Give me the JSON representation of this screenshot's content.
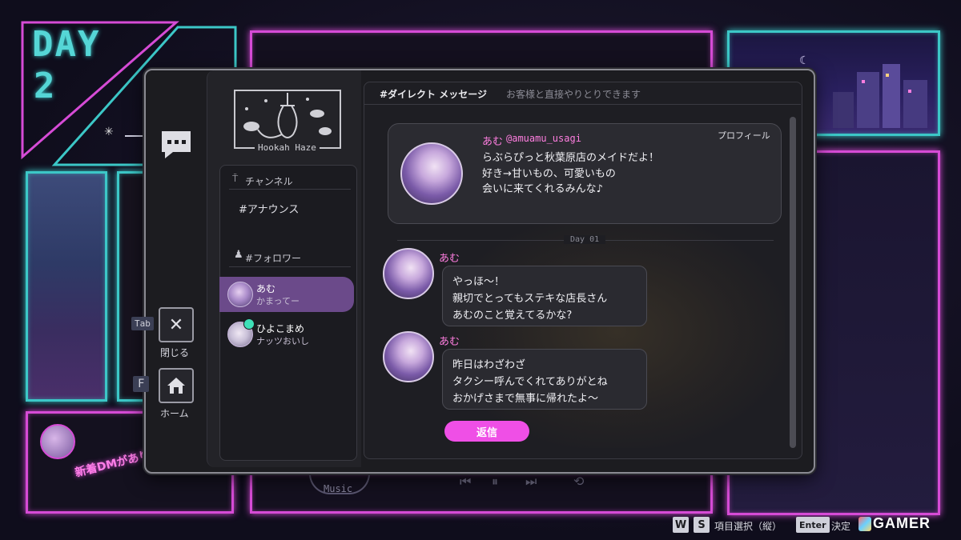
{
  "background": {
    "day_label": "DAY",
    "day_number": "2",
    "notification": "新着DMがあります",
    "music_label": "Music"
  },
  "side_rail": {
    "close_key": "Tab",
    "close_label": "閉じる",
    "home_key": "F",
    "home_label": "ホーム"
  },
  "brand": {
    "logo_caption": "Hookah Haze"
  },
  "channels": {
    "channel_header": "チャンネル",
    "announce": "#アナウンス",
    "follower_header": "#フォロワー",
    "followers": [
      {
        "name": "あむ",
        "status": "かまってー",
        "active": true
      },
      {
        "name": "ひよこまめ",
        "status": "ナッツおいし",
        "active": false
      }
    ]
  },
  "chat": {
    "title": "#ダイレクト メッセージ",
    "subtitle": "お客様と直接やりとりできます",
    "profile": {
      "name": "あむ",
      "handle": "@amuamu_usagi",
      "link": "プロフィール",
      "bio": [
        "らぶらぴっと秋葉原店のメイドだよ！",
        "好き→甘いもの、可愛いもの",
        "会いに来てくれるみんな♪"
      ]
    },
    "day_separator": "Day 01",
    "messages": [
      {
        "sender": "あむ",
        "lines": [
          "やっほ～！",
          "親切でとってもステキな店長さん",
          "あむのこと覚えてるかな?"
        ]
      },
      {
        "sender": "あむ",
        "lines": [
          "昨日はわざわざ",
          "タクシー呼んでくれてありがとね",
          "おかげさまで無事に帰れたよ～"
        ]
      }
    ],
    "reply_label": "返信"
  },
  "hints": {
    "key_w": "W",
    "key_s": "S",
    "select_label": "項目選択（縦）",
    "enter_key": "Enter",
    "confirm_label": "決定"
  },
  "watermark": "GAMER",
  "colors": {
    "neon_pink": "#d64bd6",
    "neon_cyan": "#3cc7c7",
    "accent_pink": "#ef4fe6",
    "active_row": "#6b4a8a"
  }
}
